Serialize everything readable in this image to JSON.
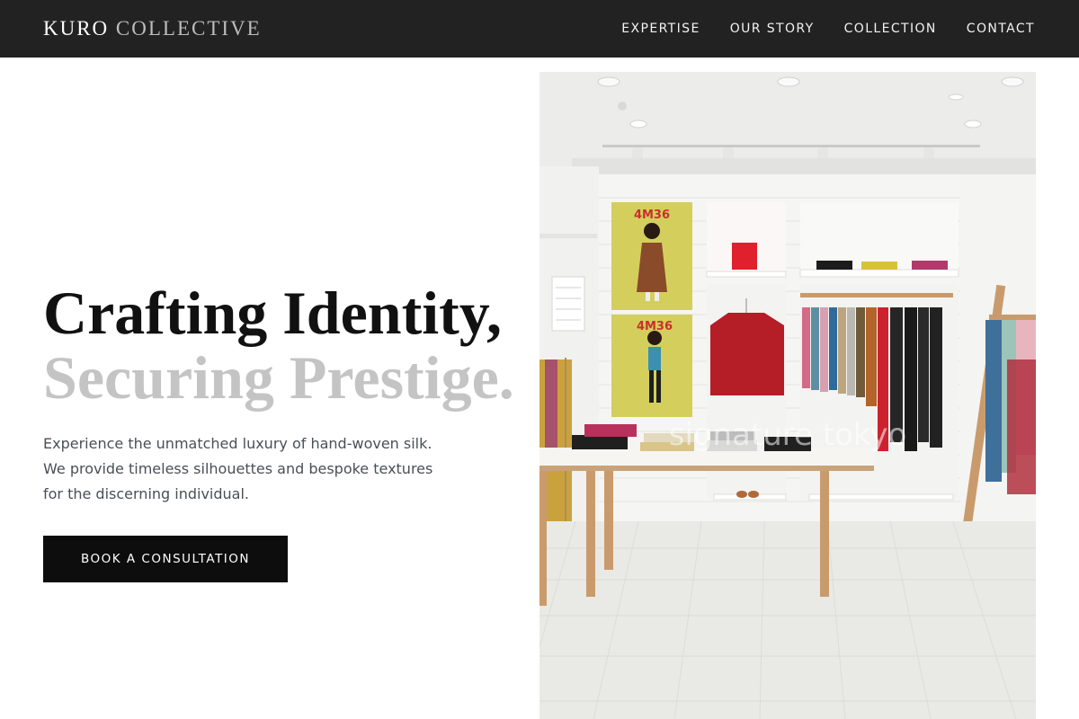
{
  "brand": {
    "part1": "KURO",
    "part2": "COLLECTIVE"
  },
  "nav": {
    "items": [
      {
        "label": "EXPERTISE"
      },
      {
        "label": "OUR STORY"
      },
      {
        "label": "COLLECTION"
      },
      {
        "label": "CONTACT"
      }
    ]
  },
  "hero": {
    "title_line1": "Crafting Identity,",
    "title_line2": "Securing Prestige.",
    "description": "Experience the unmatched luxury of hand-woven silk. We provide timeless silhouettes and bespoke textures for the discerning individual.",
    "cta_label": "BOOK A CONSULTATION"
  },
  "photo": {
    "poster_text_1": "4M36",
    "poster_text_2": "4M36",
    "watermark": "signature tokyo"
  },
  "colors": {
    "header_bg": "#222222",
    "cta_bg": "#0d0d0d",
    "title_dark": "#111111",
    "title_light": "#c4c4c4",
    "body_text": "#4a4f55"
  }
}
